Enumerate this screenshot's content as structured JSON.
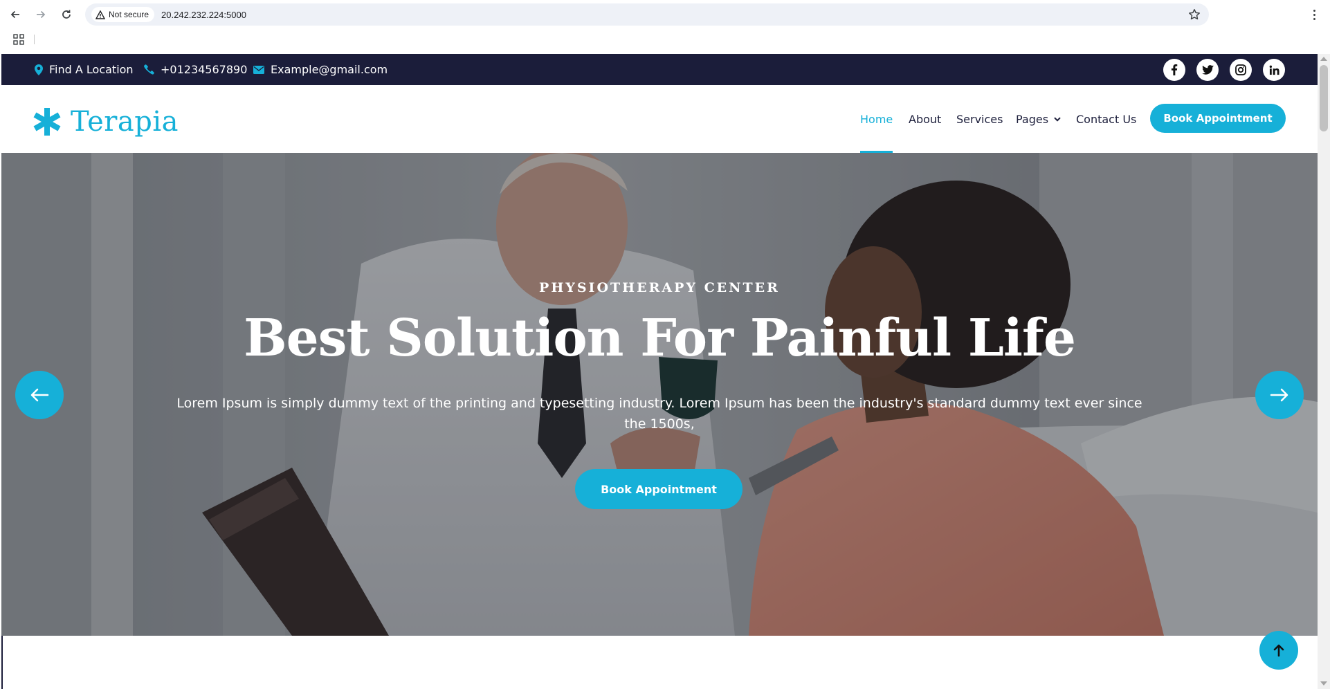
{
  "browser": {
    "security_label": "Not secure",
    "url": "20.242.232.224:5000"
  },
  "topbar": {
    "location": "Find A Location",
    "phone": "+01234567890",
    "email": "Example@gmail.com",
    "social_icons": [
      "facebook-icon",
      "twitter-icon",
      "instagram-icon",
      "linkedin-icon"
    ]
  },
  "header": {
    "logo_text": "Terapia",
    "nav": [
      {
        "label": "Home",
        "active": true
      },
      {
        "label": "About"
      },
      {
        "label": "Services"
      },
      {
        "label": "Pages",
        "has_dropdown": true
      },
      {
        "label": "Contact Us"
      }
    ],
    "cta": "Book Appointment"
  },
  "hero": {
    "subtitle": "PHYSIOTHERAPY CENTER",
    "title": "Best Solution For Painful Life",
    "text": "Lorem Ipsum is simply dummy text of the printing and typesetting industry. Lorem Ipsum has been the industry's standard dummy text ever since the 1500s,",
    "cta": "Book Appointment"
  },
  "colors": {
    "accent": "#16b0d8",
    "topbar_bg": "#1b1d3a",
    "nav_text": "#1b1d3a"
  }
}
